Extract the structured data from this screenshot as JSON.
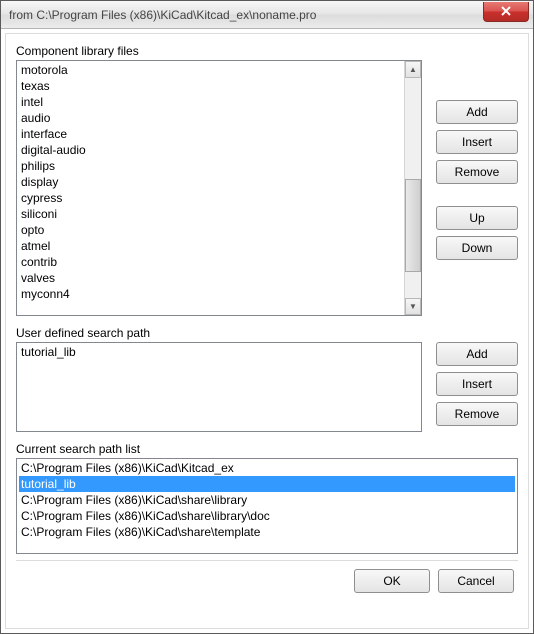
{
  "title": "from C:\\Program Files (x86)\\KiCad\\Kitcad_ex\\noname.pro",
  "sections": {
    "libs": {
      "label": "Component library files",
      "items": [
        "motorola",
        "texas",
        "intel",
        "audio",
        "interface",
        "digital-audio",
        "philips",
        "display",
        "cypress",
        "siliconi",
        "opto",
        "atmel",
        "contrib",
        "valves",
        "myconn4"
      ],
      "buttons": {
        "add": "Add",
        "insert": "Insert",
        "remove": "Remove",
        "up": "Up",
        "down": "Down"
      }
    },
    "search": {
      "label": "User defined search path",
      "items": [
        "tutorial_lib"
      ],
      "buttons": {
        "add": "Add",
        "insert": "Insert",
        "remove": "Remove"
      }
    },
    "paths": {
      "label": "Current search path list",
      "items": [
        "C:\\Program Files (x86)\\KiCad\\Kitcad_ex",
        "tutorial_lib",
        "C:\\Program Files (x86)\\KiCad\\share\\library",
        "C:\\Program Files (x86)\\KiCad\\share\\library\\doc",
        "C:\\Program Files (x86)\\KiCad\\share\\template"
      ],
      "selected_index": 1
    }
  },
  "footer": {
    "ok": "OK",
    "cancel": "Cancel"
  }
}
